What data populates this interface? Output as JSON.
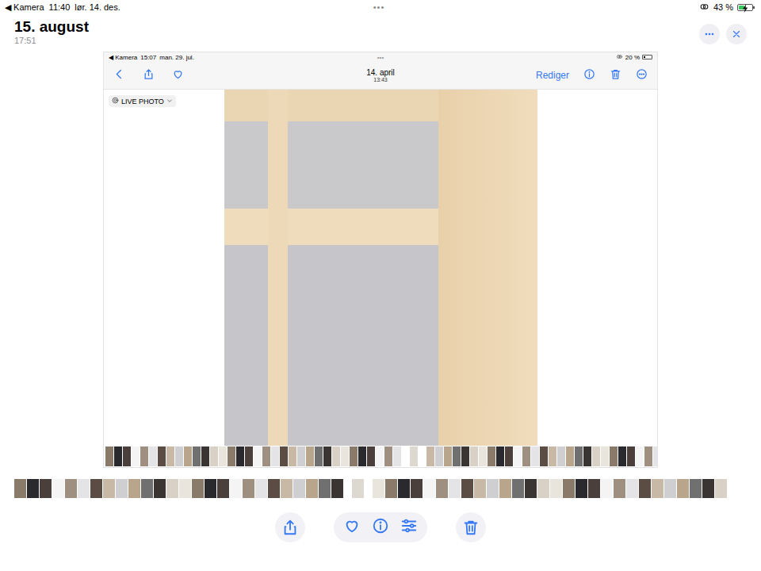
{
  "status_bar": {
    "back": "◀",
    "app": "Kamera",
    "time": "11:40",
    "date": "lør. 14. des.",
    "dots": "•••",
    "battery": "43 %",
    "battery_level": 0.43,
    "charging": true
  },
  "header": {
    "title": "15. august",
    "time": "17:51"
  },
  "screenshot": {
    "status_bar": {
      "back": "◀",
      "app": "Kamera",
      "time": "15:07",
      "date": "man. 29. jul.",
      "dots": "•••",
      "battery": "20 %",
      "battery_level": 0.2
    },
    "toolbar": {
      "title": "14. april",
      "time": "13:43",
      "edit": "Rediger"
    },
    "badge": {
      "label": "LIVE PHOTO"
    }
  }
}
